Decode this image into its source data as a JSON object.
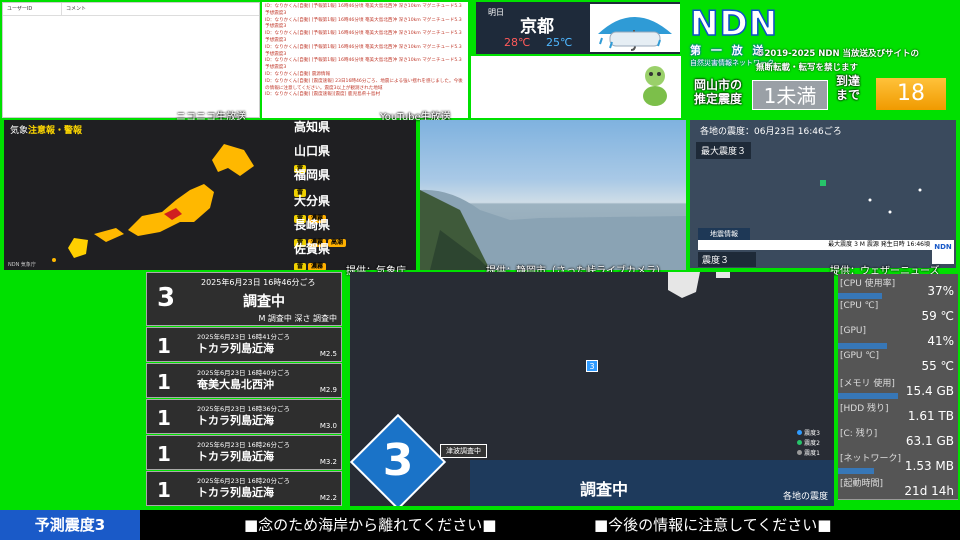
{
  "nico": {
    "col_user": "ユーザーID",
    "col_comment": "コメント",
    "caption": "ニコニコ生放送"
  },
  "youtube": {
    "caption": "YouTube生放送",
    "lines": [
      "ID：なりかくん[自動]  [予報第1報] 16時46分頃 奄美大島北西沖 深さ10km マグニチュード5.3 予想震度3",
      "ID：なりかくん[自動]  [予報第1報] 16時46分頃 奄美大島北西沖 深さ10km マグニチュード5.3 予想震度3",
      "ID：なりかくん[自動]  [予報第1報] 16時46分頃 奄美大島北西沖 深さ10km マグニチュード5.3 予想震度3",
      "ID：なりかくん[自動]  [予報第1報] 16時46分頃 奄美大島北西沖 深さ10km マグニチュード5.3 予想震度3",
      "ID：なりかくん[自動]  [予報第1報] 16時46分頃 奄美大島北西沖 深さ10km マグニチュード5.3 予想震度3",
      "ID：なりかくん[自動]  震源情報",
      "ID：なりかくん[自動]  [震度速報] 23日16時46分ごろ、地震による強い揺れを感じました。今後の情報に注意してください。震度3以上が観測された地域",
      "ID：なりかくん[自動]  [震度速報][震度] 鹿児島県十島村"
    ]
  },
  "weather": {
    "tag": "明日",
    "city": "京都",
    "high": "28℃",
    "low": "25℃"
  },
  "ndn": {
    "logo": "NDN",
    "sub": "第 一 放 送",
    "sub2": "自然災害情報ネットワーク",
    "copyright1": "©2019-2025 NDN 当放送及びサイトの",
    "copyright2": "無断転載・転写を禁じます"
  },
  "estimate": {
    "label1": "岡山市の",
    "label2": "推定震度",
    "value": "1未満",
    "arr1": "到達",
    "arr2": "まで",
    "seconds": "18"
  },
  "warning": {
    "title_prefix": "気象",
    "title_main": "注意報・警報",
    "caption": "提供：気象庁",
    "footer": "NDN 気象庁",
    "prefs": [
      {
        "name": "高知県",
        "badges": []
      },
      {
        "name": "山口県",
        "badges": [
          "雷"
        ]
      },
      {
        "name": "福岡県",
        "badges": [
          "雷"
        ]
      },
      {
        "name": "大分県",
        "badges": [
          "雷",
          "濃霧"
        ]
      },
      {
        "name": "長崎県",
        "badges": [
          "雷",
          "濃霧",
          "高潮"
        ]
      },
      {
        "name": "佐賀県",
        "badges": [
          "雷",
          "濃霧"
        ]
      }
    ]
  },
  "camera": {
    "caption": "提供：静岡市（さった峠ライブカメラ）"
  },
  "intensity_map": {
    "title": "各地の震度：06月23日 16:46ごろ",
    "max": "最大震度３",
    "info": "地震情報",
    "bar": "最大震度 3  M  震源  発生日時 16:46頃",
    "shindo": "震度３",
    "caption": "提供：ウェザーニューズ"
  },
  "quakes": [
    {
      "shindo": "3",
      "time": "2025年6月23日 16時46分ごろ",
      "name": "調査中",
      "mag": "M 調査中 深さ 調査中"
    },
    {
      "shindo": "1",
      "time": "2025年6月23日 16時41分ごろ",
      "name": "トカラ列島近海",
      "mag": "M2.5"
    },
    {
      "shindo": "1",
      "time": "2025年6月23日 16時40分ごろ",
      "name": "奄美大島北西沖",
      "mag": "M2.9"
    },
    {
      "shindo": "1",
      "time": "2025年6月23日 16時36分ごろ",
      "name": "トカラ列島近海",
      "mag": "M3.0"
    },
    {
      "shindo": "1",
      "time": "2025年6月23日 16時26分ごろ",
      "name": "トカラ列島近海",
      "mag": "M3.2"
    },
    {
      "shindo": "1",
      "time": "2025年6月23日 16時20分ごろ",
      "name": "トカラ列島近海",
      "mag": "M2.2"
    }
  ],
  "main_map": {
    "big_shindo": "3",
    "epi_marker": "3",
    "tsunami": "津波調査中",
    "status": "調査中",
    "area": "各地の震度",
    "legend": [
      "震度3",
      "震度2",
      "震度1"
    ],
    "legend_colors": [
      "#2f9bff",
      "#27c46a",
      "#9a9a9a"
    ]
  },
  "system": [
    {
      "label": "[CPU 使用率]",
      "value": "37%",
      "level": 0.37
    },
    {
      "label": "[CPU ℃]",
      "value": "59 ℃",
      "level": 0
    },
    {
      "label": "[GPU]",
      "value": "41%",
      "level": 0.41
    },
    {
      "label": "[GPU ℃]",
      "value": "55 ℃",
      "level": 0
    },
    {
      "label": "[メモリ 使用]",
      "value": "15.4 GB",
      "level": 0.5
    },
    {
      "label": "[HDD 残り]",
      "value": "1.61 TB",
      "level": 0
    },
    {
      "label": "[C: 残り]",
      "value": "63.1 GB",
      "level": 0
    },
    {
      "label": "[ネットワーク]",
      "value": "1.53 MB",
      "level": 0.3
    },
    {
      "label": "[起動時間]",
      "value": "21d 14h",
      "level": 0
    }
  ],
  "ticker": {
    "label": "予測震度3",
    "msg1": "■念のため海岸から離れてください■",
    "msg2": "■今後の情報に注意してください■"
  }
}
